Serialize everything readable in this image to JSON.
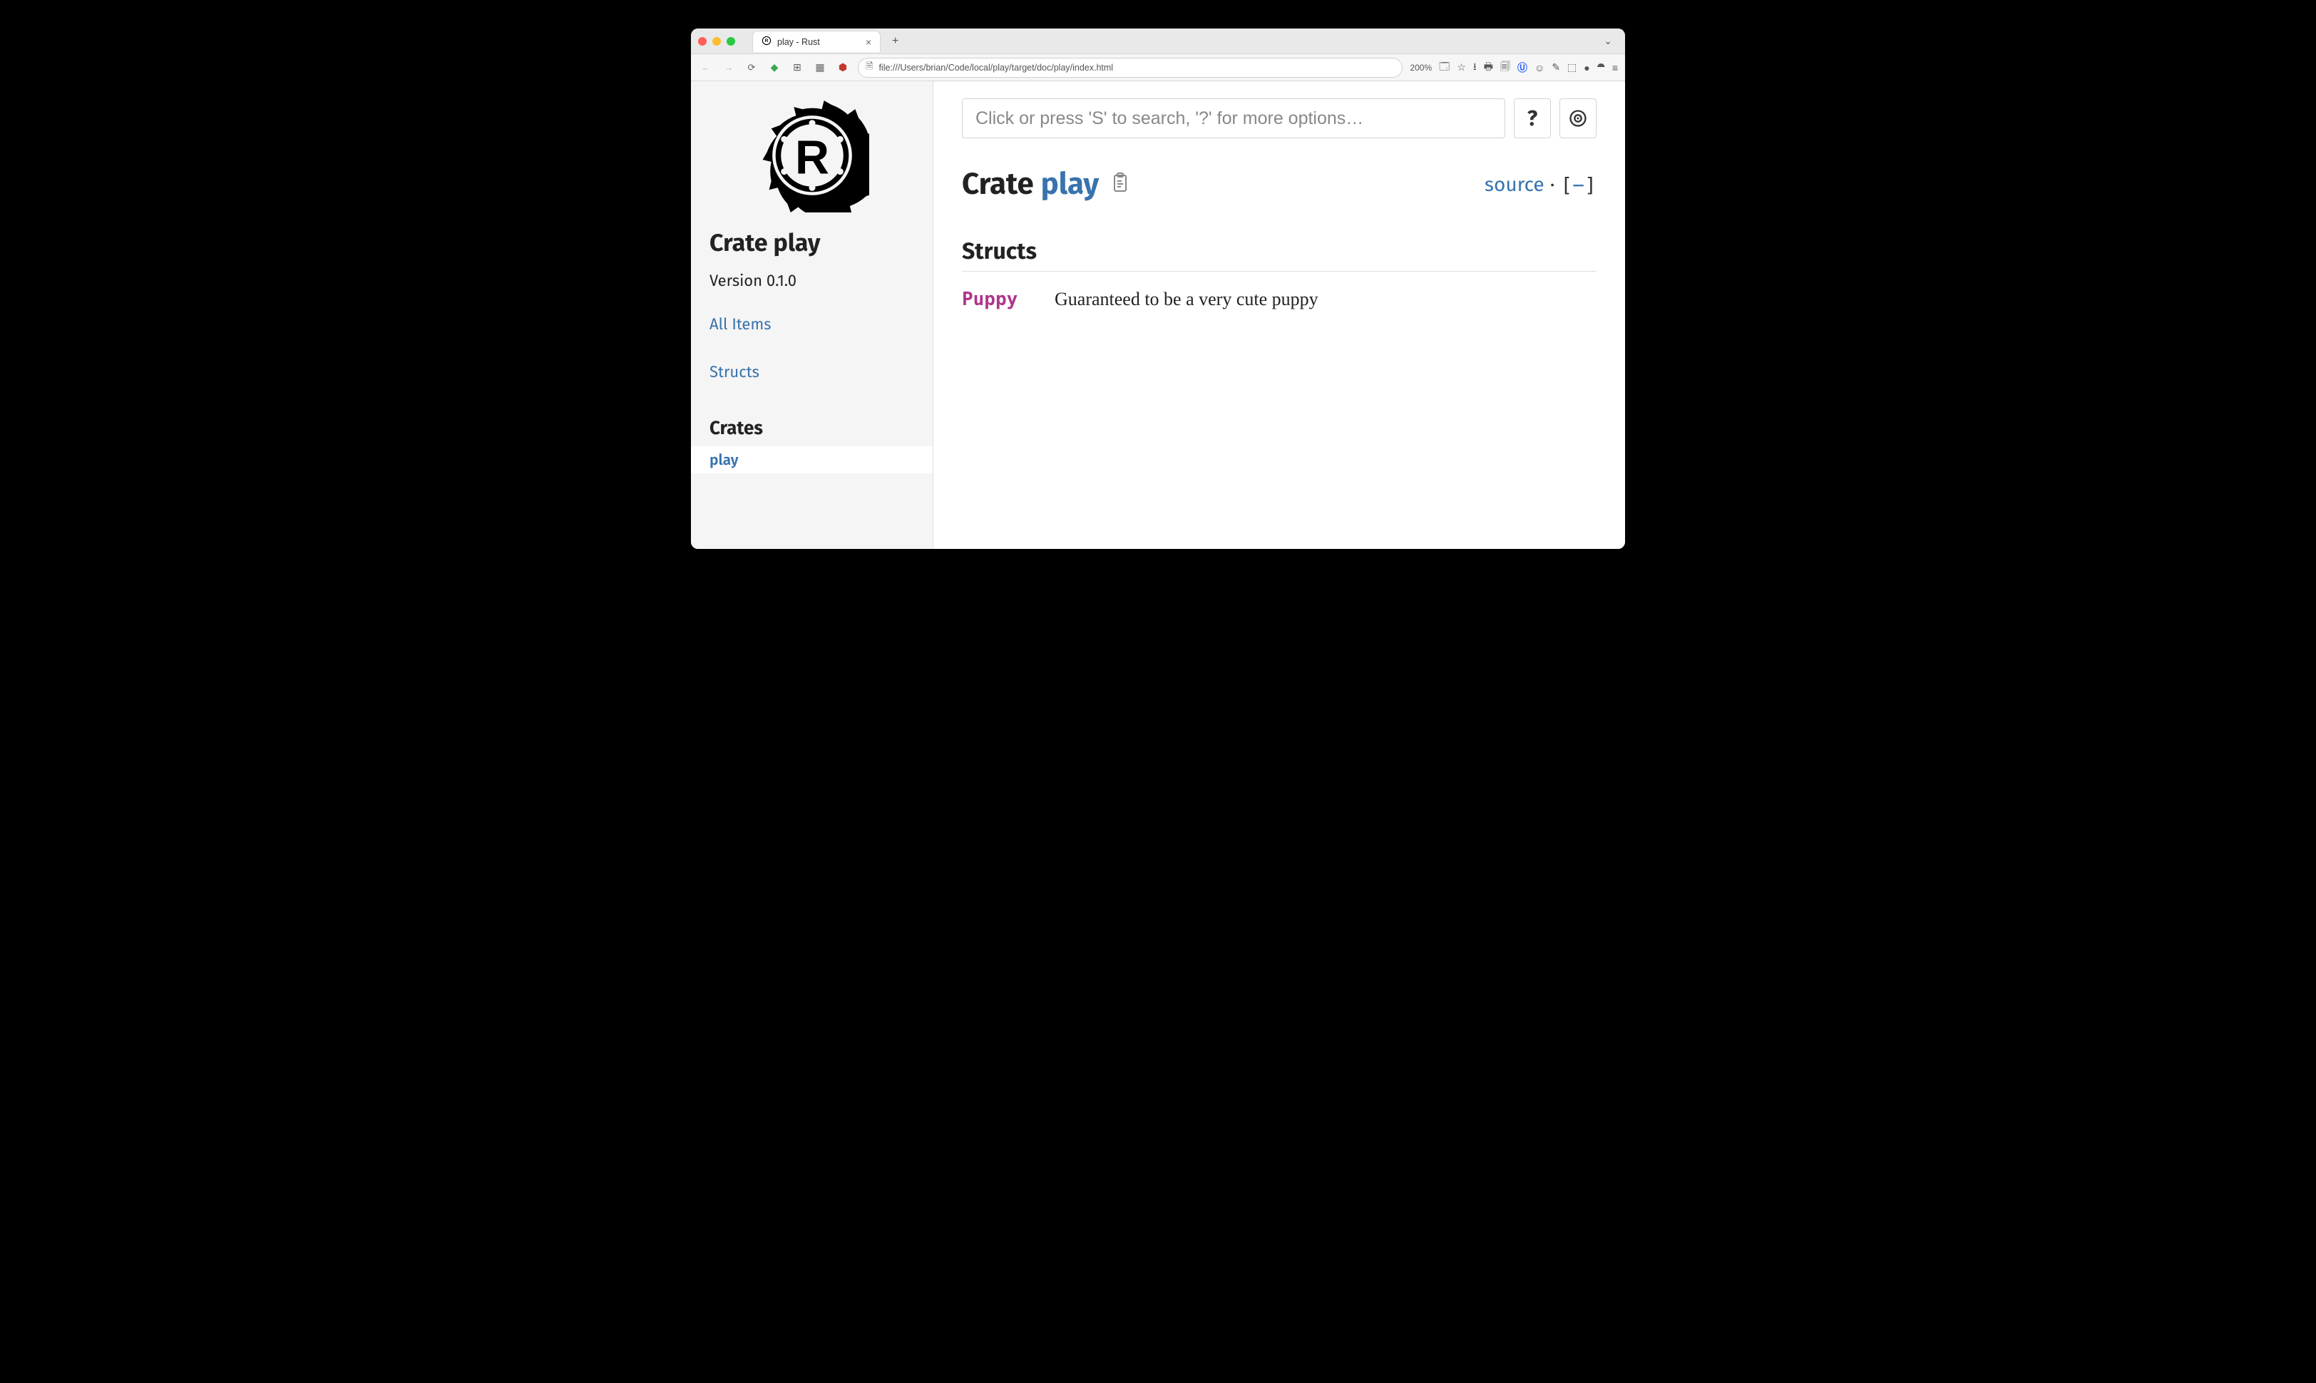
{
  "browser": {
    "tab_title": "play - Rust",
    "url": "file:///Users/brian/Code/local/play/target/doc/play/index.html",
    "zoom": "200%"
  },
  "sidebar": {
    "crate_label": "Crate play",
    "version_label": "Version 0.1.0",
    "all_items_label": "All Items",
    "structs_label": "Structs",
    "crates_heading": "Crates",
    "crate_item": "play"
  },
  "main": {
    "search_placeholder": "Click or press 'S' to search, '?' for more options…",
    "help_label": "?",
    "heading_prefix": "Crate ",
    "heading_crate": "play",
    "source_label": "source",
    "collapse_label_open": "[",
    "collapse_label_minus": "−",
    "collapse_label_close": "]",
    "section_structs": "Structs",
    "structs": [
      {
        "name": "Puppy",
        "desc": "Guaranteed to be a very cute puppy"
      }
    ]
  }
}
